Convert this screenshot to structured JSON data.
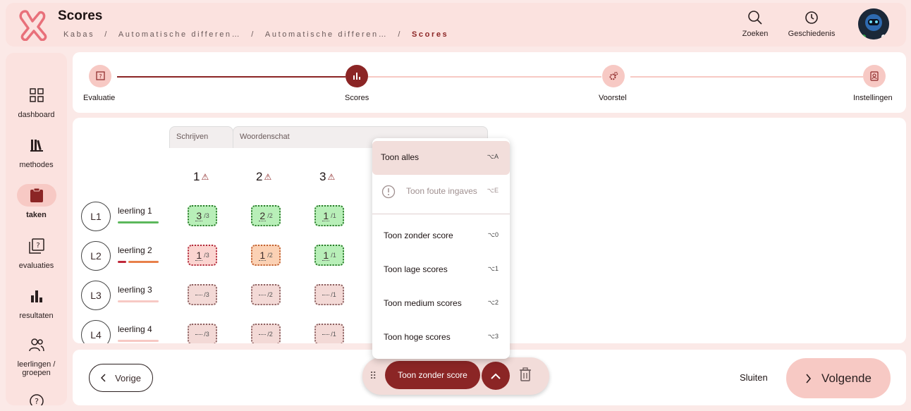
{
  "header": {
    "title": "Scores",
    "breadcrumb": [
      "Kabas",
      "Automatische differen…",
      "Automatische differen…",
      "Scores"
    ],
    "search_label": "Zoeken",
    "history_label": "Geschiedenis"
  },
  "sidebar": {
    "items": [
      {
        "label": "dashboard",
        "icon": "dashboard-icon"
      },
      {
        "label": "methodes",
        "icon": "books-icon"
      },
      {
        "label": "taken",
        "icon": "clipboard-icon",
        "active": true
      },
      {
        "label": "evaluaties",
        "icon": "evaluation-icon"
      },
      {
        "label": "resultaten",
        "icon": "bar-chart-icon"
      },
      {
        "label": "leerlingen /",
        "label2": "groepen",
        "icon": "people-icon"
      },
      {
        "label": "",
        "icon": "help-icon"
      }
    ]
  },
  "steps": [
    {
      "label": "Evaluatie"
    },
    {
      "label": "Scores",
      "active": true
    },
    {
      "label": "Voorstel"
    },
    {
      "label": "Instellingen"
    }
  ],
  "grid": {
    "tabs": [
      "Schrijven",
      "Woordenschat"
    ],
    "columns": [
      "1",
      "2",
      "3"
    ],
    "students": [
      {
        "initials": "L1",
        "name": "leerling 1",
        "scores": [
          {
            "v": "3",
            "m": "/3"
          },
          {
            "v": "2",
            "m": "/2"
          },
          {
            "v": "1",
            "m": "/1"
          }
        ]
      },
      {
        "initials": "L2",
        "name": "leerling 2",
        "scores": [
          {
            "v": "1",
            "m": "/3"
          },
          {
            "v": "1",
            "m": "/2"
          },
          {
            "v": "1",
            "m": "/1"
          }
        ]
      },
      {
        "initials": "L3",
        "name": "leerling 3",
        "scores": [
          {
            "v": "",
            "m": "/3"
          },
          {
            "v": "",
            "m": "/2"
          },
          {
            "v": "",
            "m": "/1"
          }
        ]
      },
      {
        "initials": "L4",
        "name": "leerling 4",
        "scores": [
          {
            "v": "",
            "m": "/3"
          },
          {
            "v": "",
            "m": "/2"
          },
          {
            "v": "",
            "m": "/1"
          }
        ]
      }
    ]
  },
  "menu": {
    "items": [
      {
        "label": "Toon alles",
        "shortcut": "⌥A"
      },
      {
        "label": "Toon foute ingaves",
        "shortcut": "⌥E"
      },
      {
        "label": "Toon zonder score",
        "shortcut": "⌥0"
      },
      {
        "label": "Toon lage scores",
        "shortcut": "⌥1"
      },
      {
        "label": "Toon medium scores",
        "shortcut": "⌥2"
      },
      {
        "label": "Toon hoge scores",
        "shortcut": "⌥3"
      }
    ]
  },
  "fab": {
    "main_label": "Toon zonder score"
  },
  "footer": {
    "prev": "Vorige",
    "close": "Sluiten",
    "next": "Volgende"
  },
  "colors": {
    "accent": "#8b2525",
    "soft": "#f7c9c4",
    "green": "#b8efb8"
  }
}
